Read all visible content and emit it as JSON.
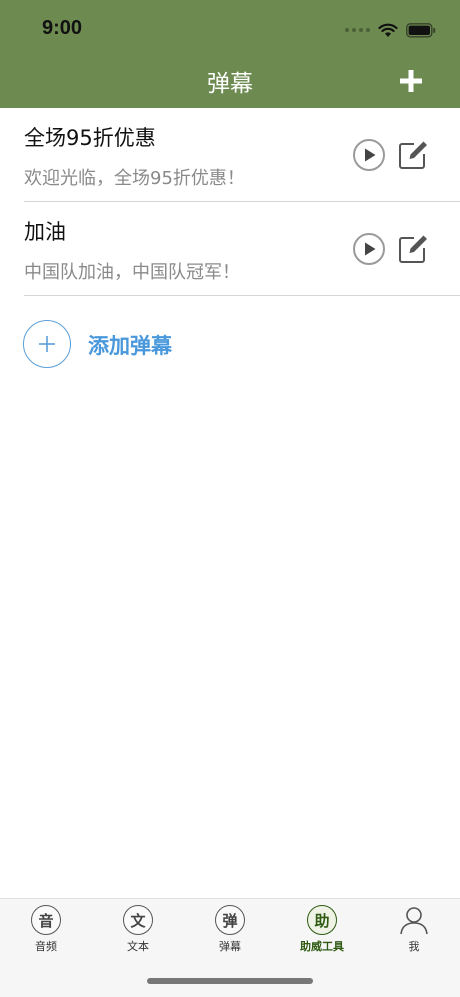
{
  "status": {
    "time": "9:00"
  },
  "header": {
    "title": "弹幕"
  },
  "barrages": [
    {
      "title": "全场95折优惠",
      "subtitle": "欢迎光临，全场95折优惠！"
    },
    {
      "title": "加油",
      "subtitle": "中国队加油，中国队冠军！"
    }
  ],
  "add_item": {
    "label": "添加弹幕"
  },
  "tabs": [
    {
      "icon_char": "音",
      "label": "音频"
    },
    {
      "icon_char": "文",
      "label": "文本"
    },
    {
      "icon_char": "弹",
      "label": "弹幕"
    },
    {
      "icon_char": "助",
      "label": "助威工具"
    },
    {
      "label": "我"
    }
  ],
  "colors": {
    "header": "#6d8a50",
    "accent": "#4a98dc",
    "active_tab": "#2e5a12"
  }
}
